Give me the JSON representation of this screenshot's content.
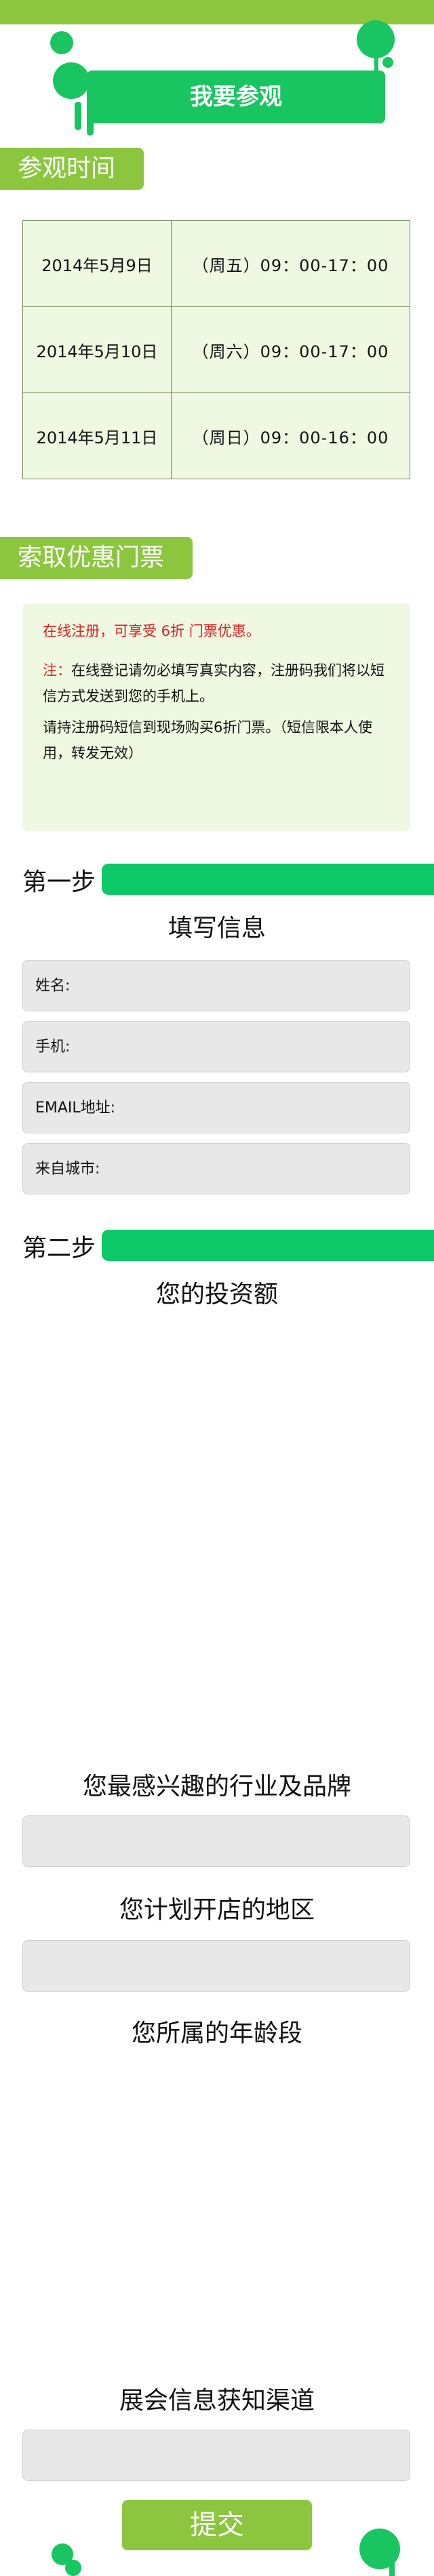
{
  "banner": {
    "title": "我要参观"
  },
  "visit_time": {
    "tag": "参观时间",
    "rows": [
      {
        "date": "2014年5月9日",
        "time": "（周五）09：00-17：00"
      },
      {
        "date": "2014年5月10日",
        "time": "（周六）09：00-17：00"
      },
      {
        "date": "2014年5月11日",
        "time": "（周日）09：00-16：00"
      }
    ]
  },
  "coupon": {
    "tag": "索取优惠门票",
    "line1": "在线注册，可享受 6折 门票优惠。",
    "note_prefix": "注：",
    "note_body": "在线登记请勿必填写真实内容，注册码我们将以短信方式发送到您的手机上。",
    "line3": "请持注册码短信到现场购买6折门票。（短信限本人使用，转发无效）"
  },
  "step1": {
    "label": "第一步",
    "heading": "填写信息",
    "fields": [
      "姓名:",
      "手机:",
      "EMAIL地址:",
      "来自城市:"
    ]
  },
  "step2": {
    "label": "第二步",
    "heading_investment": "您的投资额",
    "heading_industry": "您最感兴趣的行业及品牌",
    "heading_region": "您计划开店的地区",
    "heading_age": "您所属的年龄段",
    "heading_channel": "展会信息获知渠道"
  },
  "submit": {
    "label": "提交"
  },
  "colors": {
    "green": "#18c560",
    "lime": "#8cc63f",
    "panel": "#eff8e1",
    "red": "#e02020"
  }
}
